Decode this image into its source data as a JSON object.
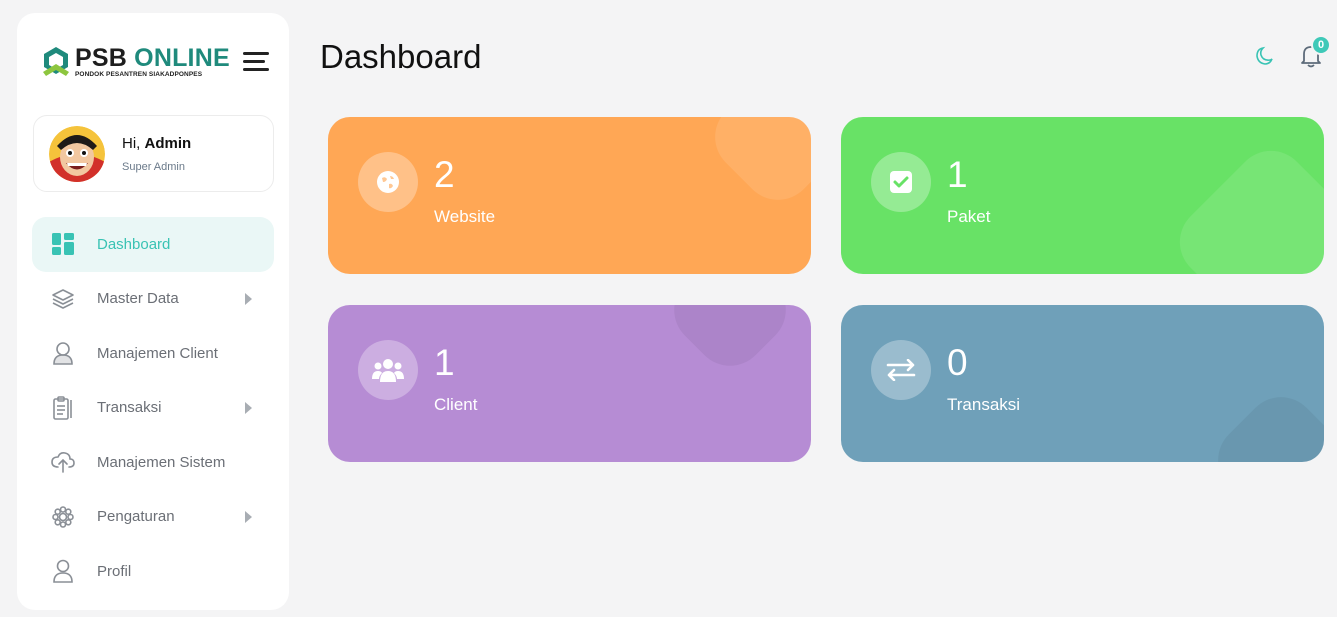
{
  "brand": {
    "title_part1": "PSB",
    "title_part2": "ONLINE",
    "subtitle": "PONDOK PESANTREN SIAKADPONPES"
  },
  "user": {
    "greeting": "Hi, ",
    "name": "Admin",
    "role": "Super Admin"
  },
  "sidebar": {
    "items": [
      {
        "label": "Dashboard",
        "icon": "dashboard-icon",
        "active": true
      },
      {
        "label": "Master Data",
        "icon": "layers-icon",
        "has_submenu": true
      },
      {
        "label": "Manajemen Client",
        "icon": "client-icon"
      },
      {
        "label": "Transaksi",
        "icon": "clipboard-icon",
        "has_submenu": true
      },
      {
        "label": "Manajemen Sistem",
        "icon": "cloud-upload-icon"
      },
      {
        "label": "Pengaturan",
        "icon": "gear-icon",
        "has_submenu": true
      },
      {
        "label": "Profil",
        "icon": "user-icon"
      }
    ]
  },
  "header": {
    "title": "Dashboard",
    "notification_count": "0"
  },
  "cards": [
    {
      "value": "2",
      "label": "Website",
      "icon": "globe-icon",
      "color": "#ffa755"
    },
    {
      "value": "1",
      "label": "Paket",
      "icon": "check-square-icon",
      "color": "#68e266"
    },
    {
      "value": "1",
      "label": "Client",
      "icon": "users-icon",
      "color": "#b68cd4"
    },
    {
      "value": "0",
      "label": "Transaksi",
      "icon": "exchange-icon",
      "color": "#6fa0b9"
    }
  ],
  "colors": {
    "accent": "#39c3b4",
    "brand_green": "#1f8a7c",
    "background": "#f4f4f5"
  }
}
